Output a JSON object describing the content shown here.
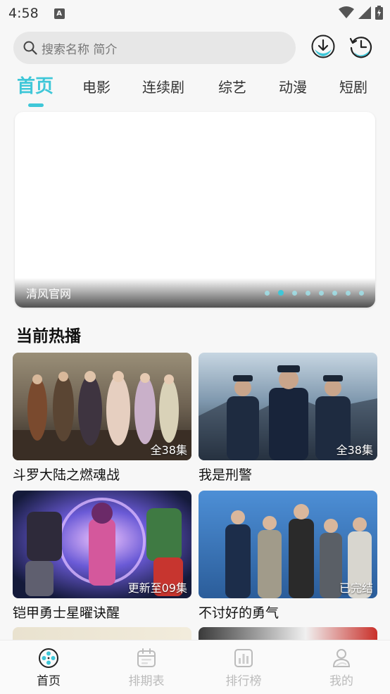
{
  "status": {
    "time": "4:58",
    "notif_letter": "A"
  },
  "search": {
    "placeholder": "搜索名称 简介"
  },
  "tabs": [
    {
      "label": "首页",
      "active": true
    },
    {
      "label": "电影",
      "active": false
    },
    {
      "label": "连续剧",
      "active": false
    },
    {
      "label": "综艺",
      "active": false
    },
    {
      "label": "动漫",
      "active": false
    },
    {
      "label": "短剧",
      "active": false
    }
  ],
  "banner": {
    "caption": "清风官网",
    "dot_count": 8,
    "active_dot": 1
  },
  "section": {
    "title": "当前热播"
  },
  "cards": [
    {
      "title": "斗罗大陆之燃魂战",
      "badge": "全38集"
    },
    {
      "title": "我是刑警",
      "badge": "全38集"
    },
    {
      "title": "铠甲勇士星曜诀醒",
      "badge": "更新至09集"
    },
    {
      "title": "不讨好的勇气",
      "badge": "已完结"
    }
  ],
  "bottom_nav": [
    {
      "label": "首页",
      "icon": "film-reel-icon",
      "active": true
    },
    {
      "label": "排期表",
      "icon": "calendar-icon",
      "active": false
    },
    {
      "label": "排行榜",
      "icon": "bar-chart-icon",
      "active": false
    },
    {
      "label": "我的",
      "icon": "profile-icon",
      "active": false
    }
  ],
  "colors": {
    "accent": "#3fc7d8",
    "background": "#f7f7f7",
    "search_bg": "#e7e7e7"
  }
}
